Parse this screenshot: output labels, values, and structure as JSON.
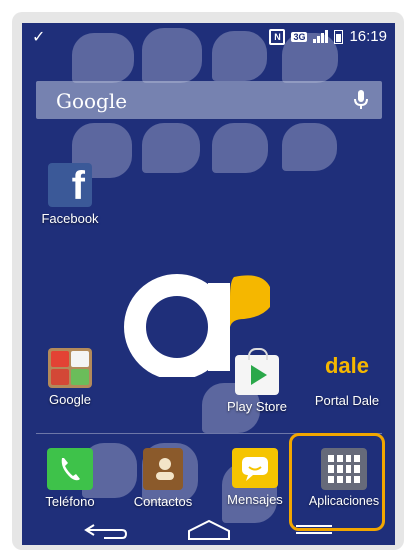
{
  "status_bar": {
    "network_type": "3G",
    "time": "16:19"
  },
  "search": {
    "label": "Google"
  },
  "home_apps": [
    {
      "name": "Facebook",
      "label": "Facebook"
    },
    {
      "name": "Google",
      "label": "Google"
    },
    {
      "name": "Play Store",
      "label": "Play Store"
    },
    {
      "name": "Portal Dale",
      "label": "Portal Dale",
      "logo_text": "dale"
    }
  ],
  "dock": [
    {
      "label": "Teléfono"
    },
    {
      "label": "Contactos"
    },
    {
      "label": "Mensajes"
    },
    {
      "label": "Aplicaciones"
    }
  ],
  "colors": {
    "wallpaper": "#1f2f7a",
    "accent_logo": "#f5b700",
    "highlight_border": "#f2a600"
  }
}
